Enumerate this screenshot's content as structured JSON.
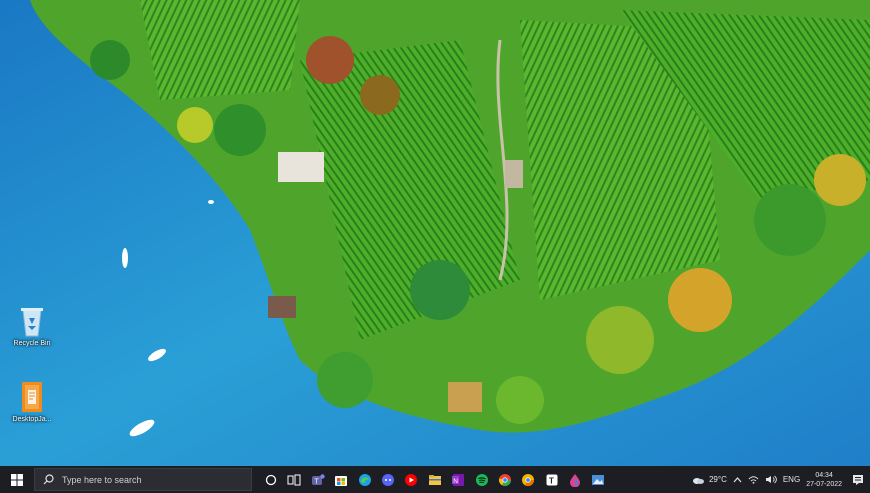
{
  "desktop": {
    "icons": [
      {
        "label": "Recycle Bin",
        "icon": "recycle-bin-icon"
      },
      {
        "label": "DesktopJa...",
        "icon": "folder-document-icon"
      }
    ]
  },
  "taskbar": {
    "start_icon": "windows-start-icon",
    "search": {
      "placeholder": "Type here to search",
      "icon": "search-icon"
    },
    "apps": [
      {
        "icon": "cortana-icon",
        "color": "#ffffff"
      },
      {
        "icon": "task-view-icon",
        "color": "#ffffff"
      },
      {
        "icon": "teams-icon",
        "color": "#6264a7"
      },
      {
        "icon": "microsoft-store-icon",
        "color": "#f25022"
      },
      {
        "icon": "edge-icon",
        "color": "#1fa0e3"
      },
      {
        "icon": "discord-icon",
        "color": "#5865f2"
      },
      {
        "icon": "youtube-music-icon",
        "color": "#ff0000"
      },
      {
        "icon": "file-explorer-icon",
        "color": "#f8c43a"
      },
      {
        "icon": "onenote-icon",
        "color": "#7719aa"
      },
      {
        "icon": "spotify-icon",
        "color": "#1db954"
      },
      {
        "icon": "chrome-icon",
        "color": "#34a853"
      },
      {
        "icon": "chrome-canary-icon",
        "color": "#f4b400"
      },
      {
        "icon": "typora-icon",
        "color": "#ffffff"
      },
      {
        "icon": "droplet-app-icon",
        "color": "#e83e8c"
      },
      {
        "icon": "photos-icon",
        "color": "#4a90d9"
      }
    ],
    "tray": {
      "weather": "29°C",
      "weather_icon": "cloud-icon",
      "chevron_icon": "chevron-up-icon",
      "network_icon": "wifi-icon",
      "volume_icon": "speaker-icon",
      "language": "ENG",
      "time": "04:34",
      "date": "27-07-2022",
      "notification_icon": "notification-icon"
    }
  }
}
